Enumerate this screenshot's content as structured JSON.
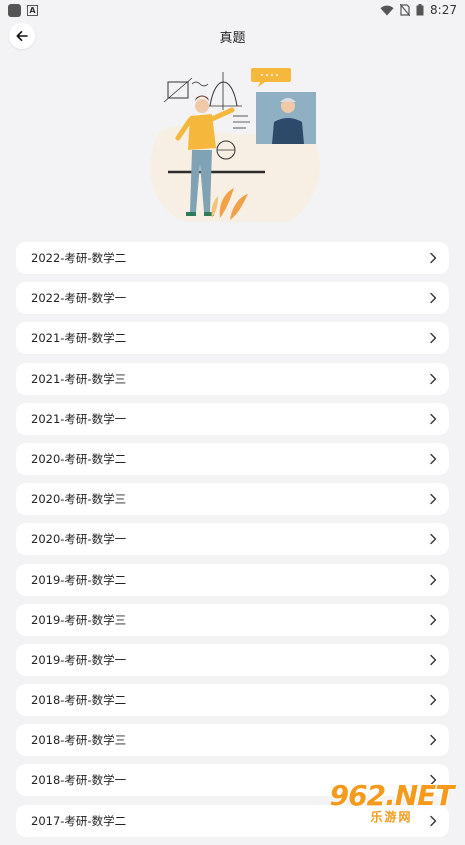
{
  "status_bar": {
    "time": "8:27"
  },
  "header": {
    "title": "真题",
    "back_icon": "arrow-left-icon"
  },
  "papers": [
    "2022-考研-数学二",
    "2022-考研-数学一",
    "2021-考研-数学二",
    "2021-考研-数学三",
    "2021-考研-数学一",
    "2020-考研-数学二",
    "2020-考研-数学三",
    "2020-考研-数学一",
    "2019-考研-数学二",
    "2019-考研-数学三",
    "2019-考研-数学一",
    "2018-考研-数学二",
    "2018-考研-数学三",
    "2018-考研-数学一",
    "2017-考研-数学二"
  ],
  "watermark": {
    "main": "962.NET",
    "sub": "乐游网"
  },
  "colors": {
    "accent": "#f5b83d",
    "background": "#f3f3f5",
    "watermark": "#f59a1a"
  }
}
